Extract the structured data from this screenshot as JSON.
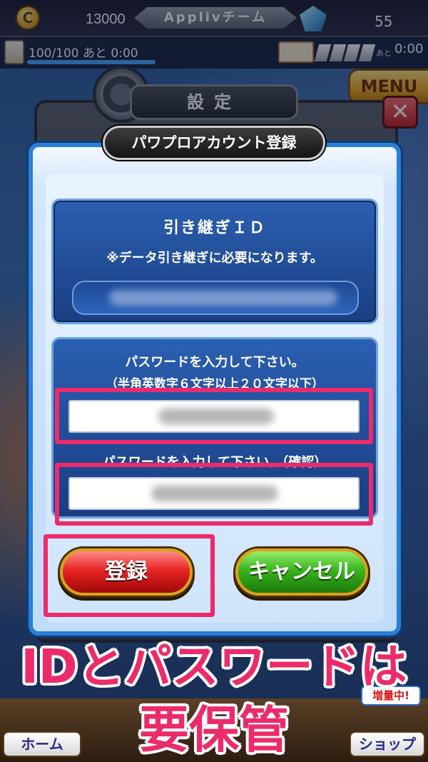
{
  "status": {
    "coins": "13000",
    "team_name": "Applivチーム",
    "gems": "55",
    "stamina": "100/100",
    "stamina_fraction": 1.0,
    "stamina_suffix": "あと 0:00",
    "refill_label": "あと",
    "refill_time": "0:00"
  },
  "header": {
    "menu_label": "MENU",
    "close_label": "✕",
    "settings_title": "設定"
  },
  "dialog": {
    "title": "パワプロアカウント登録",
    "id_section": {
      "label": "引き継ぎＩＤ",
      "note": "※データ引き継ぎに必要になります。"
    },
    "password_section": {
      "prompt": "パスワードを入力して下さい。",
      "rule": "（半角英数字６文字以上２０文字以下）",
      "confirm_prompt": "パスワードを入力して下さい。（確認）"
    },
    "buttons": {
      "register": "登録",
      "cancel": "キャンセル"
    }
  },
  "caption": {
    "line1": "IDとパスワードは",
    "line2": "要保管"
  },
  "bottom_nav": {
    "home": "ホーム",
    "shop": "ショップ",
    "increase_badge": "増量中!"
  },
  "colors": {
    "highlight": "#ec2b6a",
    "dialog_border": "#2a7fd8",
    "register_button": "#e82424",
    "cancel_button": "#38b41e"
  },
  "icons": [
    "coin-icon",
    "gem-icon",
    "stamina-icon",
    "ticket-icon",
    "gear-icon",
    "close-icon"
  ]
}
